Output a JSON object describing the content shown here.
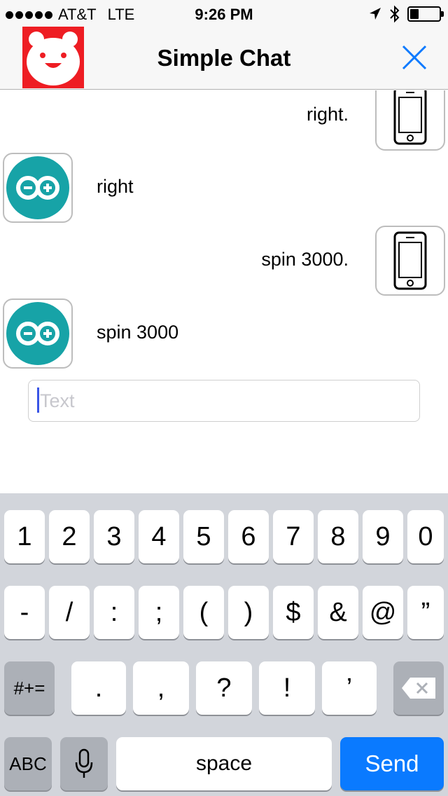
{
  "status_bar": {
    "carrier": "AT&T",
    "network": "LTE",
    "time": "9:26 PM",
    "battery_level": 0.3
  },
  "nav": {
    "title": "Simple Chat",
    "close_icon": "close-icon",
    "logo_icon": "bear-logo-icon",
    "logo_color": "#ee1d23",
    "accent_color": "#0a7aff"
  },
  "messages": [
    {
      "sender": "phone",
      "text": "right."
    },
    {
      "sender": "arduino",
      "text": "right"
    },
    {
      "sender": "phone",
      "text": "spin 3000."
    },
    {
      "sender": "arduino",
      "text": "spin 3000"
    }
  ],
  "input": {
    "placeholder": "Text",
    "value": ""
  },
  "keyboard": {
    "row1": [
      "1",
      "2",
      "3",
      "4",
      "5",
      "6",
      "7",
      "8",
      "9",
      "0"
    ],
    "row2": [
      "-",
      "/",
      ":",
      ";",
      "(",
      ")",
      "$",
      "&",
      "@",
      "”"
    ],
    "row3": [
      ".",
      ",",
      "?",
      "!",
      "’"
    ],
    "symbols_key": "#+=",
    "abc_key": "ABC",
    "space_key": "space",
    "send_key": "Send",
    "mic_icon": "microphone-icon",
    "delete_icon": "backspace-icon"
  }
}
